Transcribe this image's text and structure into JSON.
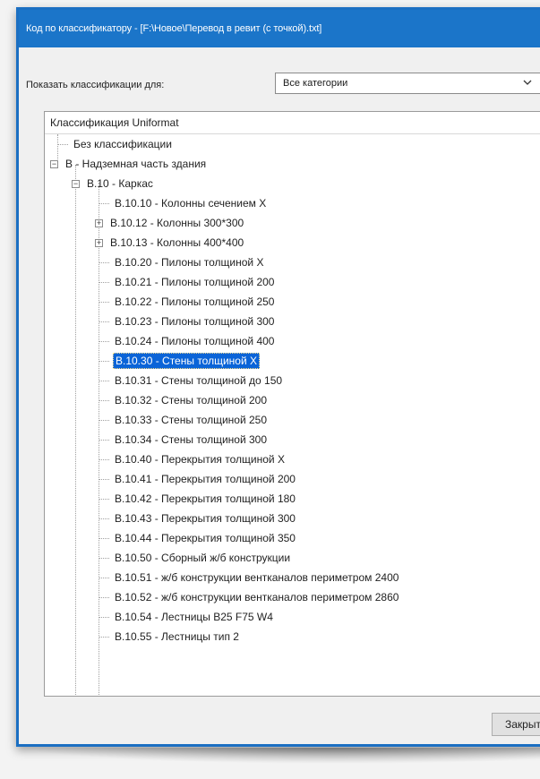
{
  "window": {
    "title": "Код по классификатору - [F:\\Новое\\Перевод в ревит (с точкой).txt]"
  },
  "filter": {
    "label": "Показать классификации для:",
    "value": "Все категории"
  },
  "tree": {
    "header": "Классификация Uniformat",
    "items": [
      {
        "label": "Без классификации"
      },
      {
        "label": "B - Надземная часть здания"
      },
      {
        "label": "B.10 - Каркас"
      },
      {
        "label": "B.10.10 - Колонны сечением Х"
      },
      {
        "label": "B.10.12 - Колонны 300*300"
      },
      {
        "label": "B.10.13 - Колонны 400*400"
      },
      {
        "label": "B.10.20 - Пилоны толщиной Х"
      },
      {
        "label": "B.10.21 - Пилоны толщиной 200"
      },
      {
        "label": "B.10.22 - Пилоны толщиной 250"
      },
      {
        "label": "B.10.23 - Пилоны толщиной 300"
      },
      {
        "label": "B.10.24 - Пилоны толщиной 400"
      },
      {
        "label": "B.10.30 - Стены толщиной Х"
      },
      {
        "label": "B.10.31 - Стены толщиной до 150"
      },
      {
        "label": "B.10.32 - Стены толщиной 200"
      },
      {
        "label": "B.10.33 - Стены толщиной 250"
      },
      {
        "label": "B.10.34 - Стены толщиной 300"
      },
      {
        "label": "B.10.40 - Перекрытия толщиной Х"
      },
      {
        "label": "B.10.41 - Перекрытия толщиной 200"
      },
      {
        "label": "B.10.42 - Перекрытия толщиной 180"
      },
      {
        "label": "B.10.43 - Перекрытия толщиной 300"
      },
      {
        "label": "B.10.44 - Перекрытия толщиной 350"
      },
      {
        "label": "B.10.50 - Сборный ж/б конструкции"
      },
      {
        "label": "B.10.51 - ж/б конструкции вентканалов периметром 2400"
      },
      {
        "label": "B.10.52 - ж/б конструкции вентканалов периметром 2860"
      },
      {
        "label": "B.10.54 - Лестницы B25 F75 W4"
      },
      {
        "label": "B.10.55 - Лестницы тип 2"
      }
    ]
  },
  "buttons": {
    "close_label": "Закрыть"
  }
}
